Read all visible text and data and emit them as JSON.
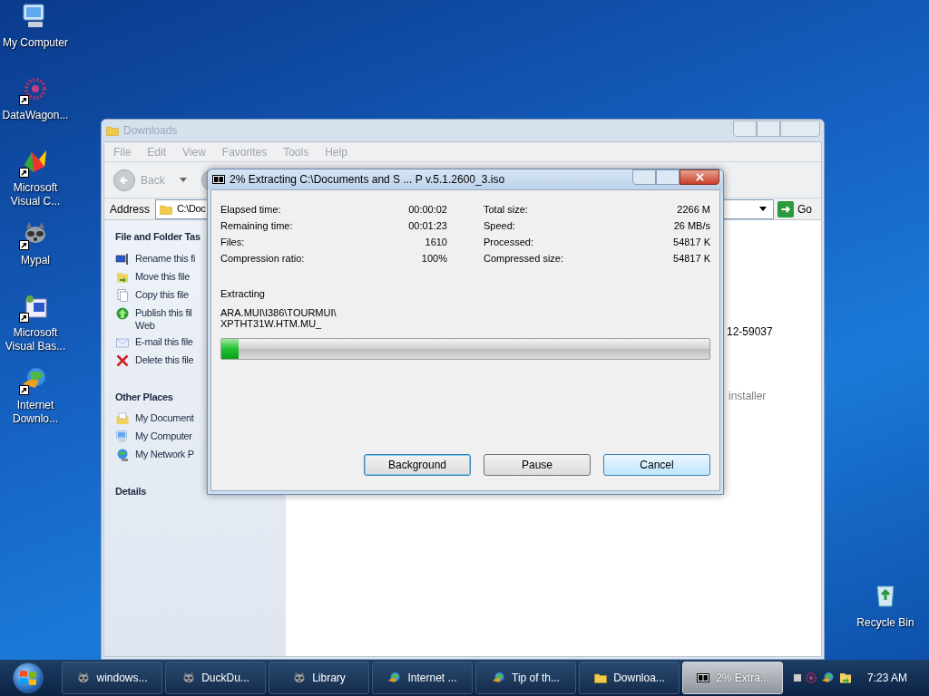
{
  "desktop_icons": [
    {
      "label": "My Computer",
      "kind": "computer",
      "shortcut": false
    },
    {
      "label": "DataWagon...",
      "kind": "flower",
      "shortcut": true
    },
    {
      "label": "Microsoft Visual C...",
      "kind": "studio",
      "shortcut": true
    },
    {
      "label": "Mypal",
      "kind": "raccoon",
      "shortcut": true
    },
    {
      "label": "Microsoft Visual Bas...",
      "kind": "vb",
      "shortcut": true
    },
    {
      "label": "Internet Downlo...",
      "kind": "globe",
      "shortcut": true
    }
  ],
  "recycle_bin": {
    "label": "Recycle Bin"
  },
  "explorer": {
    "title": "Downloads",
    "menu": [
      "File",
      "Edit",
      "View",
      "Favorites",
      "Tools",
      "Help"
    ],
    "back_label": "Back",
    "address_label": "Address",
    "address_value": "C:\\Doc",
    "go_label": "Go",
    "sections": [
      {
        "title": "File and Folder Tas",
        "items": [
          {
            "label": "Rename this fi",
            "kind": "rename"
          },
          {
            "label": "Move this file",
            "kind": "move"
          },
          {
            "label": "Copy this file",
            "kind": "copy"
          },
          {
            "label": "Publish this fil Web",
            "kind": "publish"
          },
          {
            "label": "E-mail this file",
            "kind": "mail"
          },
          {
            "label": "Delete this file",
            "kind": "delete"
          }
        ]
      },
      {
        "title": "Other Places",
        "items": [
          {
            "label": "My Document",
            "kind": "documents"
          },
          {
            "label": "My Computer",
            "kind": "computer"
          },
          {
            "label": "My Network P",
            "kind": "network"
          }
        ]
      },
      {
        "title": "Details"
      }
    ],
    "file_texts": [
      "12-59037",
      "installer"
    ]
  },
  "dialog": {
    "title": "2% Extracting C:\\Documents and S ... P v.5.1.2600_3.iso",
    "stats_left": [
      {
        "label": "Elapsed time:",
        "value": "00:00:02"
      },
      {
        "label": "Remaining time:",
        "value": "00:01:23"
      },
      {
        "label": "Files:",
        "value": "1610"
      },
      {
        "label": "Compression ratio:",
        "value": "100%"
      }
    ],
    "stats_right": [
      {
        "label": "Total size:",
        "value": "2266 M"
      },
      {
        "label": "Speed:",
        "value": "26 MB/s"
      },
      {
        "label": "Processed:",
        "value": "54817 K"
      },
      {
        "label": "Compressed size:",
        "value": "54817 K"
      }
    ],
    "status": "Extracting",
    "path": [
      "ARA.MUI\\I386\\TOURMUI\\",
      "XPTHT31W.HTM.MU_"
    ],
    "progress": {
      "level": 0.035
    },
    "buttons": [
      {
        "label": "Background",
        "focused": true,
        "hovered": false
      },
      {
        "label": "Pause",
        "focused": false,
        "hovered": false
      },
      {
        "label": "Cancel",
        "focused": false,
        "hovered": true
      }
    ]
  },
  "taskbar": {
    "buttons": [
      {
        "label": "windows...",
        "kind": "raccoon",
        "selected": false
      },
      {
        "label": "DuckDu...",
        "kind": "raccoon",
        "selected": false
      },
      {
        "label": "Library",
        "kind": "raccoon",
        "selected": false
      },
      {
        "label": "Internet ...",
        "kind": "globe",
        "selected": false
      },
      {
        "label": "Tip of th...",
        "kind": "globe",
        "selected": false
      },
      {
        "label": "Downloa...",
        "kind": "folder",
        "selected": false
      },
      {
        "label": "2% Extra...",
        "kind": "archive",
        "selected": true
      }
    ],
    "clock": "7:23 AM"
  }
}
